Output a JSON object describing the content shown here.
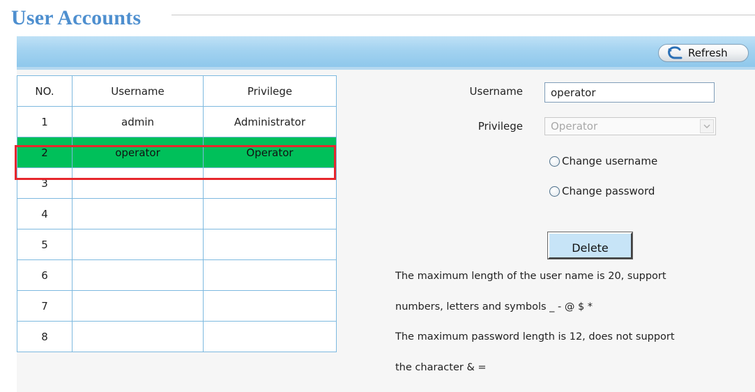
{
  "page": {
    "title": "User Accounts"
  },
  "toolbar": {
    "refresh_label": "Refresh"
  },
  "table": {
    "headers": [
      "NO.",
      "Username",
      "Privilege"
    ],
    "rows": [
      {
        "no": "1",
        "username": "admin",
        "privilege": "Administrator"
      },
      {
        "no": "2",
        "username": "operator",
        "privilege": "Operator"
      },
      {
        "no": "3",
        "username": "",
        "privilege": ""
      },
      {
        "no": "4",
        "username": "",
        "privilege": ""
      },
      {
        "no": "5",
        "username": "",
        "privilege": ""
      },
      {
        "no": "6",
        "username": "",
        "privilege": ""
      },
      {
        "no": "7",
        "username": "",
        "privilege": ""
      },
      {
        "no": "8",
        "username": "",
        "privilege": ""
      }
    ],
    "selected_row": "2",
    "selected_color": "#00c05a",
    "highlight_border_color": "#e6272d"
  },
  "form": {
    "username_label": "Username",
    "username_value": "operator",
    "privilege_label": "Privilege",
    "privilege_value": "Operator",
    "change_username_label": "Change username",
    "change_password_label": "Change password",
    "delete_label": "Delete"
  },
  "notes": {
    "line1": "The maximum length of the user name is 20, support",
    "line2": "numbers, letters and symbols _ - @ $ *",
    "line3": "The maximum password length is 12, does not support",
    "line4": "the character & ="
  },
  "colors": {
    "title": "#4e8fcf",
    "toolbar": "#a2d2f0",
    "table_border": "#7db9df"
  },
  "icons": {
    "refresh": "refresh-arrow-icon",
    "dropdown": "chevron-down-icon",
    "radio": "radio-icon"
  }
}
